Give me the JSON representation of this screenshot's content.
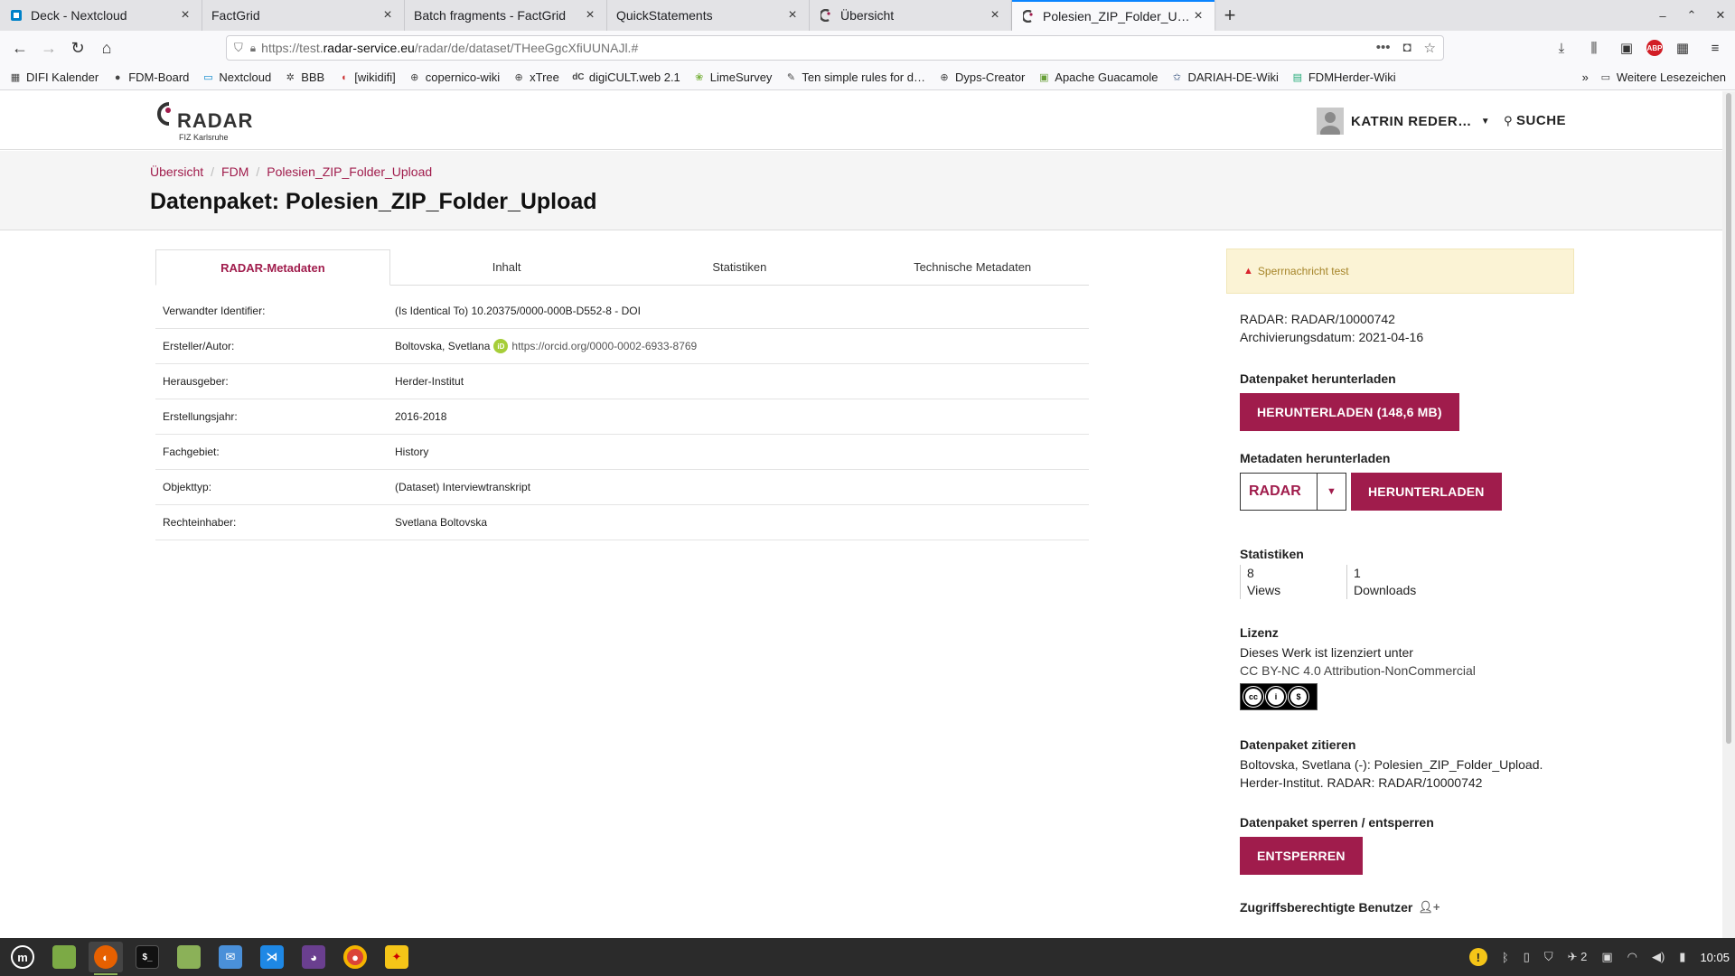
{
  "browser": {
    "tabs": [
      {
        "label": "Deck - Nextcloud",
        "icon": "deck-icon",
        "active": false
      },
      {
        "label": "FactGrid",
        "icon": "",
        "active": false
      },
      {
        "label": "Batch fragments - FactGrid",
        "icon": "",
        "active": false
      },
      {
        "label": "QuickStatements",
        "icon": "",
        "active": false
      },
      {
        "label": "Übersicht",
        "icon": "radar-favicon",
        "active": false
      },
      {
        "label": "Polesien_ZIP_Folder_Uplo…",
        "icon": "radar-favicon",
        "active": true
      }
    ],
    "url_prefix": "https://test.",
    "url_host": "radar-service.eu",
    "url_path": "/radar/de/dataset/THeeGgcXfiUUNAJl.#",
    "bookmarks": [
      {
        "label": "DIFI Kalender",
        "icon": "calendar-icon"
      },
      {
        "label": "FDM-Board",
        "icon": "github-icon"
      },
      {
        "label": "Nextcloud",
        "icon": "folder-icon"
      },
      {
        "label": "BBB",
        "icon": "bbb-icon"
      },
      {
        "label": "[wikidifi]",
        "icon": "wiki-icon"
      },
      {
        "label": "copernico-wiki",
        "icon": "globe-icon"
      },
      {
        "label": "xTree",
        "icon": "globe-icon"
      },
      {
        "label": "digiCULT.web 2.1",
        "icon": "dc-icon"
      },
      {
        "label": "LimeSurvey",
        "icon": "lime-icon"
      },
      {
        "label": "Ten simple rules for d…",
        "icon": "rules-icon"
      },
      {
        "label": "Dyps-Creator",
        "icon": "globe-icon"
      },
      {
        "label": "Apache Guacamole",
        "icon": "guacamole-icon"
      },
      {
        "label": "DARIAH-DE-Wiki",
        "icon": "star-icon"
      },
      {
        "label": "FDMHerder-Wiki",
        "icon": "wiki-icon"
      }
    ],
    "other_bookmarks": "Weitere Lesezeichen"
  },
  "site": {
    "logo_text": "RADAR",
    "logo_sub": "FIZ Karlsruhe",
    "user_name": "KATRIN REDER…",
    "search_label": "SUCHE"
  },
  "breadcrumb": [
    "Übersicht",
    "FDM",
    "Polesien_ZIP_Folder_Upload"
  ],
  "page_title": "Datenpaket: Polesien_ZIP_Folder_Upload",
  "tabs": [
    "RADAR-Metadaten",
    "Inhalt",
    "Statistiken",
    "Technische Metadaten"
  ],
  "metadata": [
    {
      "label": "Verwandter Identifier:",
      "value": "(Is Identical To) 10.20375/0000-000B-D552-8 - DOI"
    },
    {
      "label": "Ersteller/Autor:",
      "value": "Boltovska, Svetlana",
      "orcid": "https://orcid.org/0000-0002-6933-8769"
    },
    {
      "label": "Herausgeber:",
      "value": "Herder-Institut"
    },
    {
      "label": "Erstellungsjahr:",
      "value": "2016-2018"
    },
    {
      "label": "Fachgebiet:",
      "value": "History"
    },
    {
      "label": "Objekttyp:",
      "value": "(Dataset) Interviewtranskript"
    },
    {
      "label": "Rechteinhaber:",
      "value": "Svetlana Boltovska"
    }
  ],
  "sidebar": {
    "alert": "Sperrnachricht test",
    "radar_id": "RADAR: RADAR/10000742",
    "archive_date": "Archivierungsdatum: 2021-04-16",
    "download_heading": "Datenpaket herunterladen",
    "download_button": "HERUNTERLADEN (148,6 MB)",
    "meta_heading": "Metadaten herunterladen",
    "meta_format": "RADAR",
    "meta_button": "HERUNTERLADEN",
    "stats_heading": "Statistiken",
    "views_count": "8",
    "views_label": "Views",
    "downloads_count": "1",
    "downloads_label": "Downloads",
    "license_heading": "Lizenz",
    "license_text": "Dieses Werk ist lizenziert unter",
    "license_name": "CC BY-NC 4.0 Attribution-NonCommercial",
    "cite_heading": "Datenpaket zitieren",
    "cite_line1": "Boltovska, Svetlana (-): Polesien_ZIP_Folder_Upload.",
    "cite_line2": "Herder-Institut. RADAR: RADAR/10000742",
    "lock_heading": "Datenpaket sperren / entsperren",
    "lock_button": "ENTSPERREN",
    "users_heading": "Zugriffsberechtigte Benutzer"
  },
  "taskbar": {
    "clock": "10:05",
    "notification_count": "2"
  },
  "colors": {
    "accent": "#a01c4c",
    "alert_bg": "#fbf3d5",
    "taskbar": "#2b2b2b"
  }
}
